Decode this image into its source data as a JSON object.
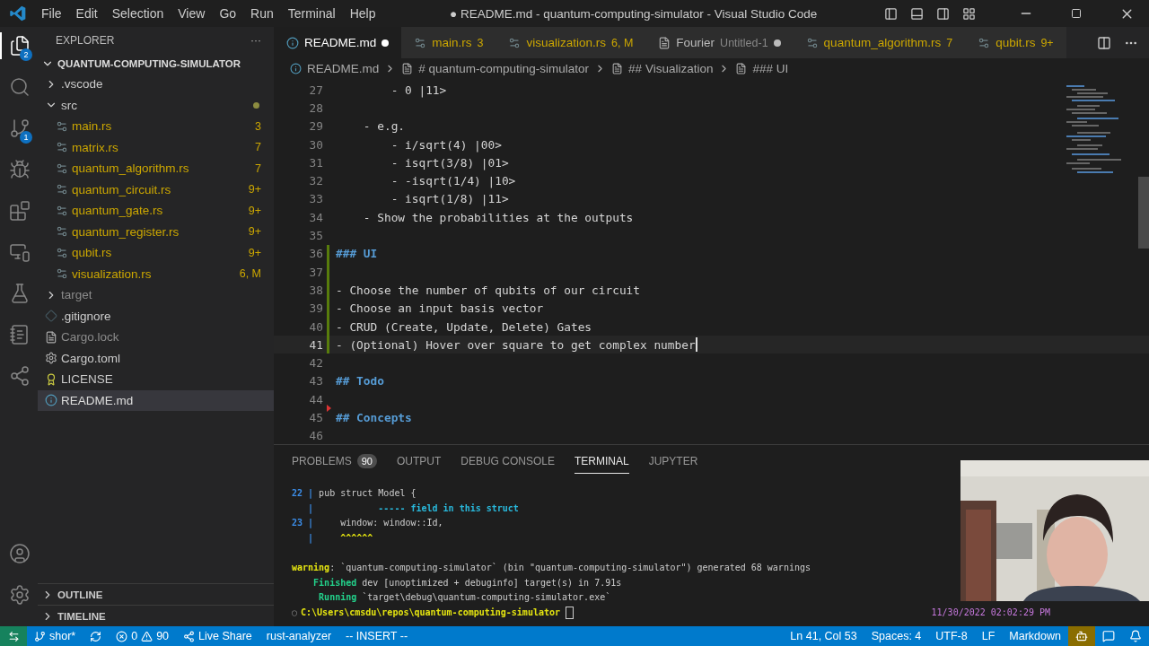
{
  "title_bar": {
    "menus": [
      "File",
      "Edit",
      "Selection",
      "View",
      "Go",
      "Run",
      "Terminal",
      "Help"
    ],
    "title": "● README.md - quantum-computing-simulator - Visual Studio Code"
  },
  "activity_bar": {
    "items": [
      {
        "kind": "files",
        "selected": true,
        "badge": "2"
      },
      {
        "kind": "search",
        "selected": false
      },
      {
        "kind": "source-control",
        "selected": false,
        "badge": "1"
      },
      {
        "kind": "debug",
        "selected": false
      },
      {
        "kind": "extensions",
        "selected": false
      },
      {
        "kind": "remote",
        "selected": false
      },
      {
        "kind": "testing",
        "selected": false
      },
      {
        "kind": "notebook",
        "selected": false
      },
      {
        "kind": "share",
        "selected": false
      }
    ],
    "bottom": [
      {
        "kind": "account"
      },
      {
        "kind": "settings"
      }
    ]
  },
  "sidebar": {
    "title": "EXPLORER",
    "more": "···",
    "project": "QUANTUM-COMPUTING-SIMULATOR",
    "items": [
      {
        "name": ".vscode",
        "kind": "folder",
        "expanded": false,
        "ignored": false,
        "selected": false
      },
      {
        "name": "src",
        "kind": "folder",
        "expanded": true,
        "ignored": false,
        "selected": false,
        "modified": true,
        "children": [
          {
            "name": "main.rs",
            "kind": "rust",
            "badge": "3",
            "warning": true,
            "selected": false
          },
          {
            "name": "matrix.rs",
            "kind": "rust",
            "badge": "7",
            "warning": true,
            "selected": false
          },
          {
            "name": "quantum_algorithm.rs",
            "kind": "rust",
            "badge": "7",
            "warning": true,
            "selected": false
          },
          {
            "name": "quantum_circuit.rs",
            "kind": "rust",
            "badge": "9+",
            "warning": true,
            "selected": false
          },
          {
            "name": "quantum_gate.rs",
            "kind": "rust",
            "badge": "9+",
            "warning": true,
            "selected": false
          },
          {
            "name": "quantum_register.rs",
            "kind": "rust",
            "badge": "9+",
            "warning": true,
            "selected": false
          },
          {
            "name": "qubit.rs",
            "kind": "rust",
            "badge": "9+",
            "warning": true,
            "selected": false
          },
          {
            "name": "visualization.rs",
            "kind": "rust",
            "badge": "6, M",
            "warning": true,
            "selected": false
          }
        ]
      },
      {
        "name": "target",
        "kind": "folder",
        "expanded": false,
        "ignored": true,
        "selected": false
      },
      {
        "name": ".gitignore",
        "kind": "git",
        "ignored": false,
        "selected": false
      },
      {
        "name": "Cargo.lock",
        "kind": "lock",
        "ignored": true,
        "selected": false
      },
      {
        "name": "Cargo.toml",
        "kind": "toml",
        "ignored": false,
        "selected": false
      },
      {
        "name": "LICENSE",
        "kind": "license",
        "ignored": false,
        "selected": false
      },
      {
        "name": "README.md",
        "kind": "markdown",
        "ignored": false,
        "selected": true
      }
    ],
    "sections": [
      {
        "title": "OUTLINE",
        "expanded": false
      },
      {
        "title": "TIMELINE",
        "expanded": false
      }
    ]
  },
  "tabs": [
    {
      "label": "README.md",
      "kind": "markdown",
      "selected": true,
      "dirty": true,
      "warning": false
    },
    {
      "label": "main.rs",
      "kind": "rust",
      "selected": false,
      "badge": "3",
      "warning": true
    },
    {
      "label": "visualization.rs",
      "kind": "rust",
      "selected": false,
      "badge": "6, M",
      "warning": true
    },
    {
      "label": "Fourier",
      "kind": "untitled",
      "selected": false,
      "detail": "Untitled-1",
      "dirty": true,
      "warning": false
    },
    {
      "label": "quantum_algorithm.rs",
      "kind": "rust",
      "selected": false,
      "badge": "7",
      "warning": true
    },
    {
      "label": "qubit.rs",
      "kind": "rust",
      "selected": false,
      "badge": "9+",
      "warning": true
    }
  ],
  "breadcrumbs": [
    "README.md",
    "# quantum-computing-simulator",
    "## Visualization",
    "### UI"
  ],
  "editor": {
    "lines": [
      {
        "number": "27",
        "text": "        - 0 |11>",
        "kind": "text"
      },
      {
        "number": "28",
        "kind": "empty"
      },
      {
        "number": "29",
        "text": "    - e.g.",
        "kind": "text"
      },
      {
        "number": "30",
        "text": "        - i/sqrt(4) |00>",
        "kind": "text"
      },
      {
        "number": "31",
        "text": "        - isqrt(3/8) |01>",
        "kind": "text"
      },
      {
        "number": "32",
        "text": "        - -isqrt(1/4) |10>",
        "kind": "text"
      },
      {
        "number": "33",
        "text": "        - isqrt(1/8) |11>",
        "kind": "text"
      },
      {
        "number": "34",
        "text": "    - Show the probabilities at the outputs",
        "kind": "text"
      },
      {
        "number": "35",
        "kind": "empty"
      },
      {
        "number": "36",
        "text": "### UI",
        "kind": "heading",
        "modified": true
      },
      {
        "number": "37",
        "kind": "empty",
        "modified": true
      },
      {
        "number": "38",
        "text": "- Choose the number of qubits of our circuit",
        "kind": "text",
        "modified": true
      },
      {
        "number": "39",
        "text": "- Choose an input basis vector",
        "kind": "text",
        "modified": true
      },
      {
        "number": "40",
        "text": "- CRUD (Create, Update, Delete) Gates",
        "kind": "text",
        "modified": true
      },
      {
        "number": "41",
        "text": "- (Optional) Hover over square to get complex number",
        "kind": "text",
        "modified": true,
        "current": true
      },
      {
        "number": "42",
        "kind": "empty"
      },
      {
        "number": "43",
        "text": "## Todo",
        "kind": "heading"
      },
      {
        "number": "44",
        "kind": "empty"
      },
      {
        "number": "45",
        "text": "## Concepts",
        "kind": "heading",
        "deleted_marker": true
      },
      {
        "number": "46",
        "kind": "empty"
      }
    ]
  },
  "panel": {
    "tabs": [
      {
        "label": "PROBLEMS",
        "badge": "90",
        "selected": false
      },
      {
        "label": "OUTPUT",
        "selected": false
      },
      {
        "label": "DEBUG CONSOLE",
        "selected": false
      },
      {
        "label": "TERMINAL",
        "selected": true
      },
      {
        "label": "JUPYTER",
        "selected": false
      }
    ],
    "diagnostic": [
      [
        {
          "text": "22 | ",
          "kind": "gutter"
        },
        {
          "text": "pub struct Model {",
          "kind": "plain"
        }
      ],
      [
        {
          "text": "   |            ",
          "kind": "gutter"
        },
        {
          "text": "----- field in this struct",
          "kind": "note"
        }
      ],
      [
        {
          "text": "23 | ",
          "kind": "gutter"
        },
        {
          "text": "    window: window::Id,",
          "kind": "plain"
        }
      ],
      [
        {
          "text": "   |     ",
          "kind": "gutter"
        },
        {
          "text": "^^^^^^",
          "kind": "caret"
        }
      ]
    ],
    "summary": [
      [
        {
          "text": "warning",
          "kind": "warning"
        },
        {
          "text": ": `quantum-computing-simulator` (bin \"quantum-computing-simulator\") generated 68 warnings",
          "kind": "plain"
        }
      ],
      [
        {
          "text": "    Finished",
          "kind": "success"
        },
        {
          "text": " dev [unoptimized + debuginfo] target(s) in 7.91s",
          "kind": "plain"
        }
      ],
      [
        {
          "text": "     Running",
          "kind": "success"
        },
        {
          "text": " `target\\debug\\quantum-computing-simulator.exe`",
          "kind": "plain"
        }
      ]
    ],
    "prompt_marker": "○",
    "prompt": "C:\\Users\\cmsdu\\repos\\quantum-computing-simulator",
    "clock": "11/30/2022 02:02:29 PM"
  },
  "webcam": {
    "kind": "picture"
  },
  "status_bar": {
    "left": [
      {
        "kind": "branch",
        "text": "shor*"
      },
      {
        "kind": "sync"
      },
      {
        "kind": "problems",
        "errors": "0",
        "warnings": "90"
      },
      {
        "kind": "share",
        "text": "Live Share"
      },
      {
        "kind": "plain",
        "text": "rust-analyzer"
      },
      {
        "kind": "plain",
        "text": "-- INSERT --"
      }
    ],
    "right": [
      {
        "kind": "plain",
        "text": "Ln 41, Col 53"
      },
      {
        "kind": "plain",
        "text": "Spaces: 4"
      },
      {
        "kind": "plain",
        "text": "UTF-8"
      },
      {
        "kind": "plain",
        "text": "LF"
      },
      {
        "kind": "plain",
        "text": "Markdown"
      },
      {
        "kind": "copilot"
      },
      {
        "kind": "feedback"
      },
      {
        "kind": "bell"
      }
    ]
  }
}
